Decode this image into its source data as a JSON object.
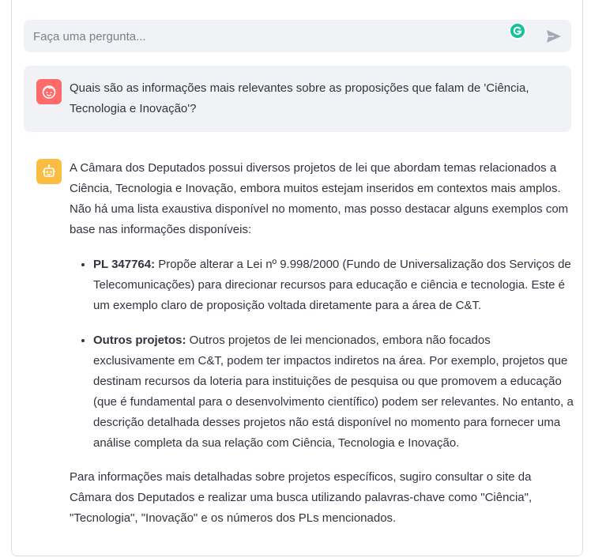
{
  "chat_input": {
    "placeholder": "Faça uma pergunta..."
  },
  "icons": {
    "grammarly": "grammarly-icon",
    "send": "send-icon",
    "user_avatar": "user-face-icon",
    "bot_avatar": "robot-icon"
  },
  "colors": {
    "user_avatar": "#ff6b6b",
    "bot_avatar": "#fbbd41",
    "message_bg": "#f0f2f6",
    "grammarly": "#15c39a"
  },
  "user_message": {
    "text": "Quais são as informações mais relevantes sobre as proposições que falam de 'Ciência, Tecnologia e Inovação'?"
  },
  "assistant_message": {
    "intro": "A Câmara dos Deputados possui diversos projetos de lei que abordam temas relacionados a Ciência, Tecnologia e Inovação, embora muitos estejam inseridos em contextos mais amplos. Não há uma lista exaustiva disponível no momento, mas posso destacar alguns exemplos com base nas informações disponíveis:",
    "items": [
      {
        "title": "PL 347764:",
        "text": " Propõe alterar a Lei nº 9.998/2000 (Fundo de Universalização dos Serviços de Telecomunicações) para direcionar recursos para educação e ciência e tecnologia. Este é um exemplo claro de proposição voltada diretamente para a área de C&T."
      },
      {
        "title": "Outros projetos:",
        "text": " Outros projetos de lei mencionados, embora não focados exclusivamente em C&T, podem ter impactos indiretos na área. Por exemplo, projetos que destinam recursos da loteria para instituições de pesquisa ou que promovem a educação (que é fundamental para o desenvolvimento científico) podem ser relevantes. No entanto, a descrição detalhada desses projetos não está disponível no momento para fornecer uma análise completa da sua relação com Ciência, Tecnologia e Inovação."
      }
    ],
    "closing": "Para informações mais detalhadas sobre projetos específicos, sugiro consultar o site da Câmara dos Deputados e realizar uma busca utilizando palavras-chave como \"Ciência\", \"Tecnologia\", \"Inovação\" e os números dos PLs mencionados."
  }
}
